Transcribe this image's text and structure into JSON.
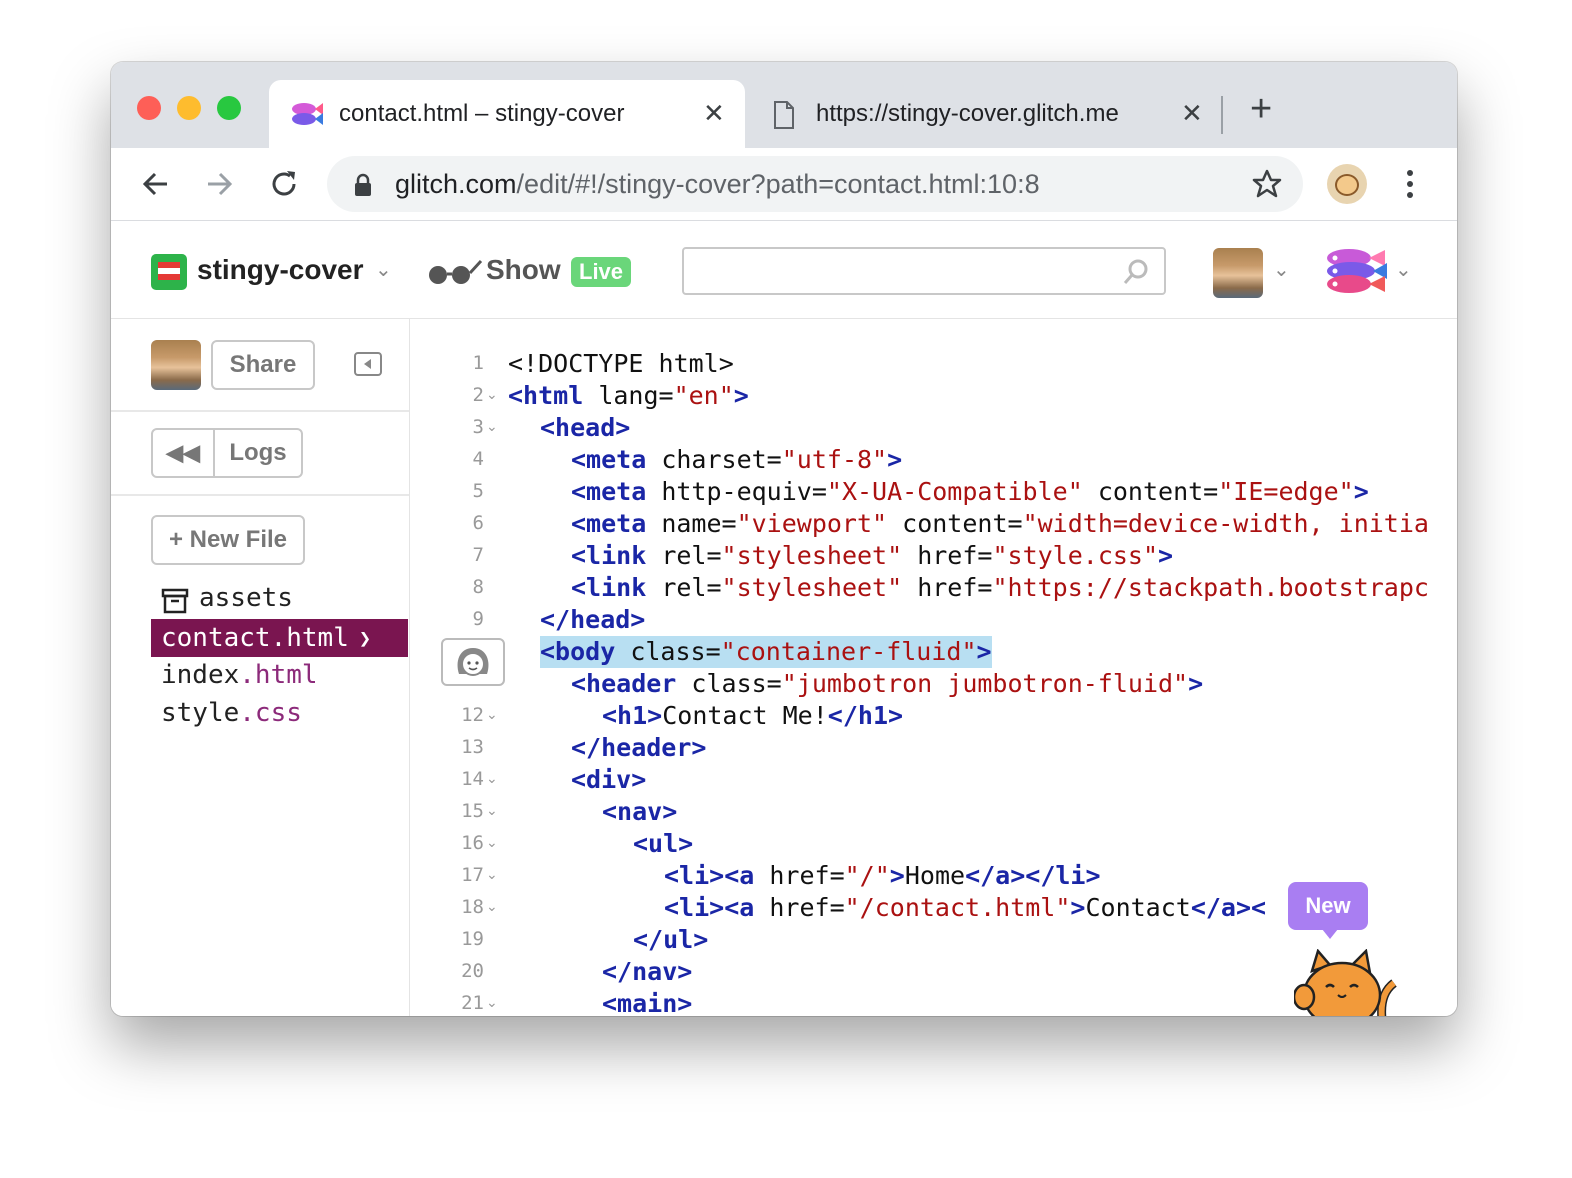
{
  "browser": {
    "tabs": [
      {
        "title": "contact.html – stingy-cover",
        "icon": "glitch-fish-icon",
        "close": "✕"
      },
      {
        "title": "https://stingy-cover.glitch.me",
        "icon": "page-icon",
        "close": "✕"
      }
    ],
    "new_tab": "+",
    "url_host": "glitch.com",
    "url_path": "/edit/#!/stingy-cover?path=contact.html:10:8"
  },
  "glitch": {
    "project_name": "stingy-cover",
    "show_label": "Show",
    "live_badge": "Live",
    "search_placeholder": ""
  },
  "sidebar": {
    "share_label": "Share",
    "logs_label": "Logs",
    "new_file_label": "+ New File",
    "files": [
      {
        "name": "assets",
        "ext": ""
      },
      {
        "name": "contact",
        "ext": ".html"
      },
      {
        "name": "index",
        "ext": ".html"
      },
      {
        "name": "style",
        "ext": ".css"
      }
    ]
  },
  "editor": {
    "lines": [
      {
        "n": "1",
        "fold": false
      },
      {
        "n": "2",
        "fold": true
      },
      {
        "n": "3",
        "fold": true
      },
      {
        "n": "4",
        "fold": false
      },
      {
        "n": "5",
        "fold": false
      },
      {
        "n": "6",
        "fold": false
      },
      {
        "n": "7",
        "fold": false
      },
      {
        "n": "8",
        "fold": false
      },
      {
        "n": "9",
        "fold": false
      },
      {
        "n": "",
        "fold": false
      },
      {
        "n": "",
        "fold": false
      },
      {
        "n": "12",
        "fold": true
      },
      {
        "n": "13",
        "fold": false
      },
      {
        "n": "14",
        "fold": true
      },
      {
        "n": "15",
        "fold": true
      },
      {
        "n": "16",
        "fold": true
      },
      {
        "n": "17",
        "fold": true
      },
      {
        "n": "18",
        "fold": true
      },
      {
        "n": "19",
        "fold": false
      },
      {
        "n": "20",
        "fold": false
      },
      {
        "n": "21",
        "fold": true
      }
    ],
    "code": {
      "l1": "<!DOCTYPE html>",
      "l2_tag": "<html",
      "l2_attr": " lang=",
      "l2_val": "\"en\"",
      "l2_end": ">",
      "l3": "<head>",
      "l4_tag": "<meta",
      "l4_attr": " charset=",
      "l4_val": "\"utf-8\"",
      "l4_end": ">",
      "l5_tag": "<meta",
      "l5_attr1": " http-equiv=",
      "l5_val1": "\"X-UA-Compatible\"",
      "l5_attr2": " content=",
      "l5_val2": "\"IE=edge\"",
      "l5_end": ">",
      "l6_tag": "<meta",
      "l6_attr1": " name=",
      "l6_val1": "\"viewport\"",
      "l6_attr2": " content=",
      "l6_val2": "\"width=device-width, initia",
      "l7_tag": "<link",
      "l7_attr1": " rel=",
      "l7_val1": "\"stylesheet\"",
      "l7_attr2": " href=",
      "l7_val2": "\"style.css\"",
      "l7_end": ">",
      "l8_tag": "<link",
      "l8_attr1": " rel=",
      "l8_val1": "\"stylesheet\"",
      "l8_attr2": " href=",
      "l8_val2": "\"https://stackpath.bootstrapc",
      "l9": "</head>",
      "l10_tag": "<body",
      "l10_attr": " class=",
      "l10_val": "\"container-fluid\"",
      "l10_end": ">",
      "l11_tag": "<header",
      "l11_attr": " class=",
      "l11_val": "\"jumbotron jumbotron-fluid\"",
      "l11_end": ">",
      "l12_open": "<h1>",
      "l12_text": "Contact Me!",
      "l12_close": "</h1>",
      "l13": "</header>",
      "l14": "<div>",
      "l15": "<nav>",
      "l16": "<ul>",
      "l17_open": "<li><a",
      "l17_attr": " href=",
      "l17_val": "\"/\"",
      "l17_gt": ">",
      "l17_text": "Home",
      "l17_close": "</a></li>",
      "l18_open": "<li><a",
      "l18_attr": " href=",
      "l18_val": "\"/contact.html\"",
      "l18_gt": ">",
      "l18_text": "Contact",
      "l18_close": "</a><",
      "l19": "</ul>",
      "l20": "</nav>",
      "l21": "<main>"
    },
    "new_badge": "New"
  }
}
